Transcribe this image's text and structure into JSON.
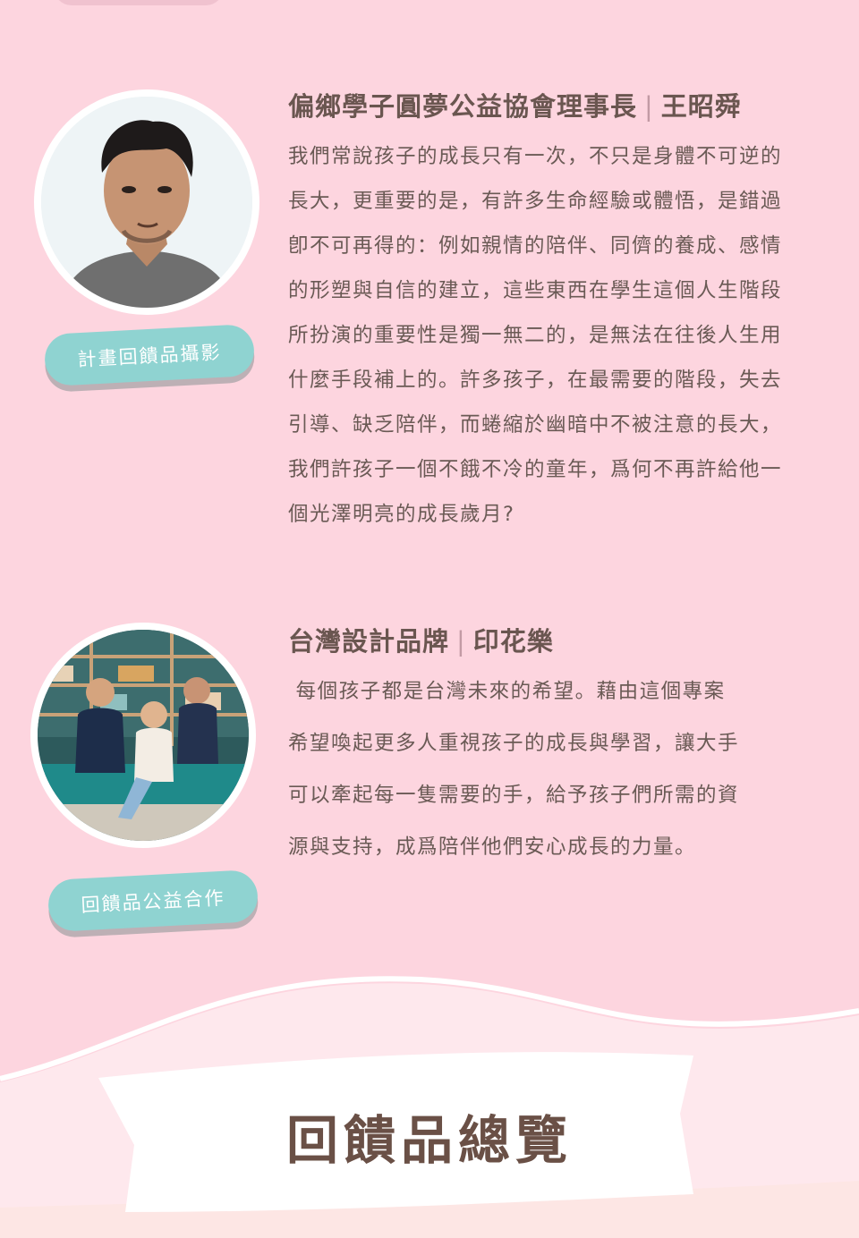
{
  "section1": {
    "tag": "計畫回饋品攝影",
    "title_org": "偏鄉學子圓夢公益協會理事長",
    "title_name": "王昭舜",
    "lines": [
      "我們常說孩子的成長只有一次，不只是身體不可逆的",
      "長大，更重要的是，有許多生命經驗或體悟，是錯過",
      "卽不可再得的：例如親情的陪伴、同儕的養成、感情",
      "的形塑與自信的建立，這些東西在學生這個人生階段",
      "所扮演的重要性是獨一無二的，是無法在往後人生用",
      "什麼手段補上的。許多孩子，在最需要的階段，失去",
      "引導、缺乏陪伴，而蜷縮於幽暗中不被注意的長大，",
      "我們許孩子一個不餓不冷的童年，爲何不再許給他一",
      "個光澤明亮的成長歲月?"
    ]
  },
  "section2": {
    "tag": "回饋品公益合作",
    "title_org": "台灣設計品牌",
    "title_name": "印花樂",
    "lines": [
      " 每個孩子都是台灣未來的希望。藉由這個專案",
      "希望喚起更多人重視孩子的成長與學習，讓大手",
      "可以牽起每一隻需要的手，給予孩子們所需的資",
      "源與支持，成爲陪伴他們安心成長的力量。"
    ]
  },
  "banner": {
    "label": "回饋品總覽"
  },
  "colors": {
    "background": "#fdd5df",
    "tag": "#8fd3d1",
    "title": "#6a5650",
    "banner": "#ffffff",
    "footer": "#fde6e4"
  }
}
